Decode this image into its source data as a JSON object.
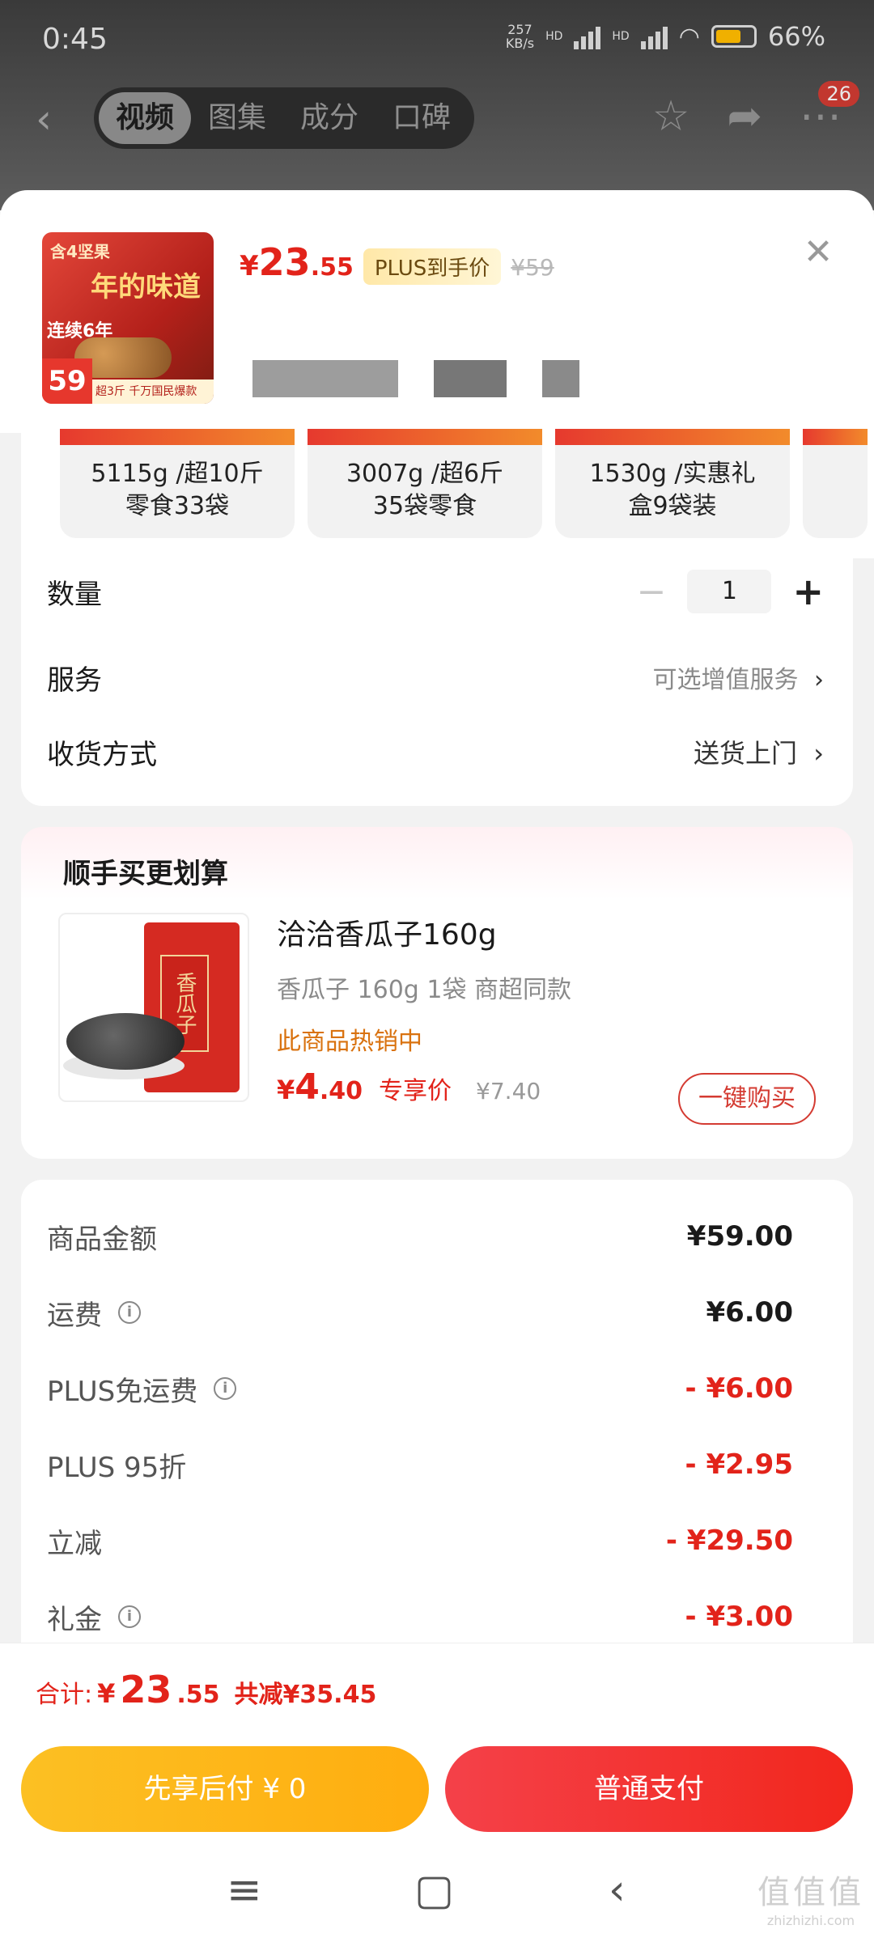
{
  "status_bar": {
    "time": "0:45",
    "net_speed_top": "257",
    "net_speed_unit": "KB/s",
    "battery": "66%",
    "hd1": "HD",
    "hd2": "HD"
  },
  "nav": {
    "tabs": [
      "视频",
      "图集",
      "成分",
      "口碑"
    ],
    "active_tab": 0,
    "badge": "26"
  },
  "product": {
    "thumb_brand": "含4坚果",
    "thumb_title": "年的味道",
    "thumb_years": "连续6年",
    "thumb_price": "59",
    "thumb_foot": "超3斤 千万国民爆款",
    "price_currency": "¥",
    "price_int": "23",
    "price_dec": ".55",
    "plus_tag": "PLUS到手价",
    "orig_price": "¥59"
  },
  "variants": [
    {
      "text": "5115g /超10斤零食33袋"
    },
    {
      "text": "3007g /超6斤35袋零食"
    },
    {
      "text": "1530g /实惠礼盒9袋装"
    }
  ],
  "options": {
    "quantity_label": "数量",
    "quantity_value": "1",
    "minus": "−",
    "plus": "+",
    "service_label": "服务",
    "service_value": "可选增值服务",
    "delivery_label": "收货方式",
    "delivery_value": "送货上门",
    "chevron": "›"
  },
  "bundle": {
    "title": "顺手买更划算",
    "bag_label": "香瓜子",
    "item_name": "洽洽香瓜子160g",
    "item_spec": "香瓜子 160g 1袋 商超同款",
    "hot_tag": "此商品热销中",
    "price_currency": "¥",
    "price_int": "4",
    "price_dec": ".40",
    "exclusive": "专享价",
    "orig_price": "¥7.40",
    "buy_button": "一键购买"
  },
  "fees": [
    {
      "label": "商品金额",
      "amount": "¥59.00",
      "info": false,
      "discount": false
    },
    {
      "label": "运费",
      "amount": "¥6.00",
      "info": true,
      "discount": false
    },
    {
      "label": "PLUS免运费",
      "amount": "- ¥6.00",
      "info": true,
      "discount": true
    },
    {
      "label": "PLUS 95折",
      "amount": "- ¥2.95",
      "info": false,
      "discount": true
    },
    {
      "label": "立减",
      "amount": "- ¥29.50",
      "info": false,
      "discount": true
    },
    {
      "label": "礼金",
      "amount": "- ¥3.00",
      "info": true,
      "discount": true
    }
  ],
  "total": {
    "label": "合计:",
    "currency": "¥",
    "int": "23",
    "dec": ".55",
    "savings": "共减¥35.45"
  },
  "pay": {
    "later": "先享后付 ¥ 0",
    "normal": "普通支付"
  },
  "system_nav": {
    "menu": "≡",
    "home": "▢",
    "back": "‹"
  },
  "watermark": {
    "logo": "值值值",
    "domain": "zhizhizhi.com"
  },
  "colors": {
    "accent_red": "#e2231a",
    "plus_gold": "#ffe8a8",
    "pay_later": "#fcc023",
    "pay_normal": "#f2271d"
  }
}
